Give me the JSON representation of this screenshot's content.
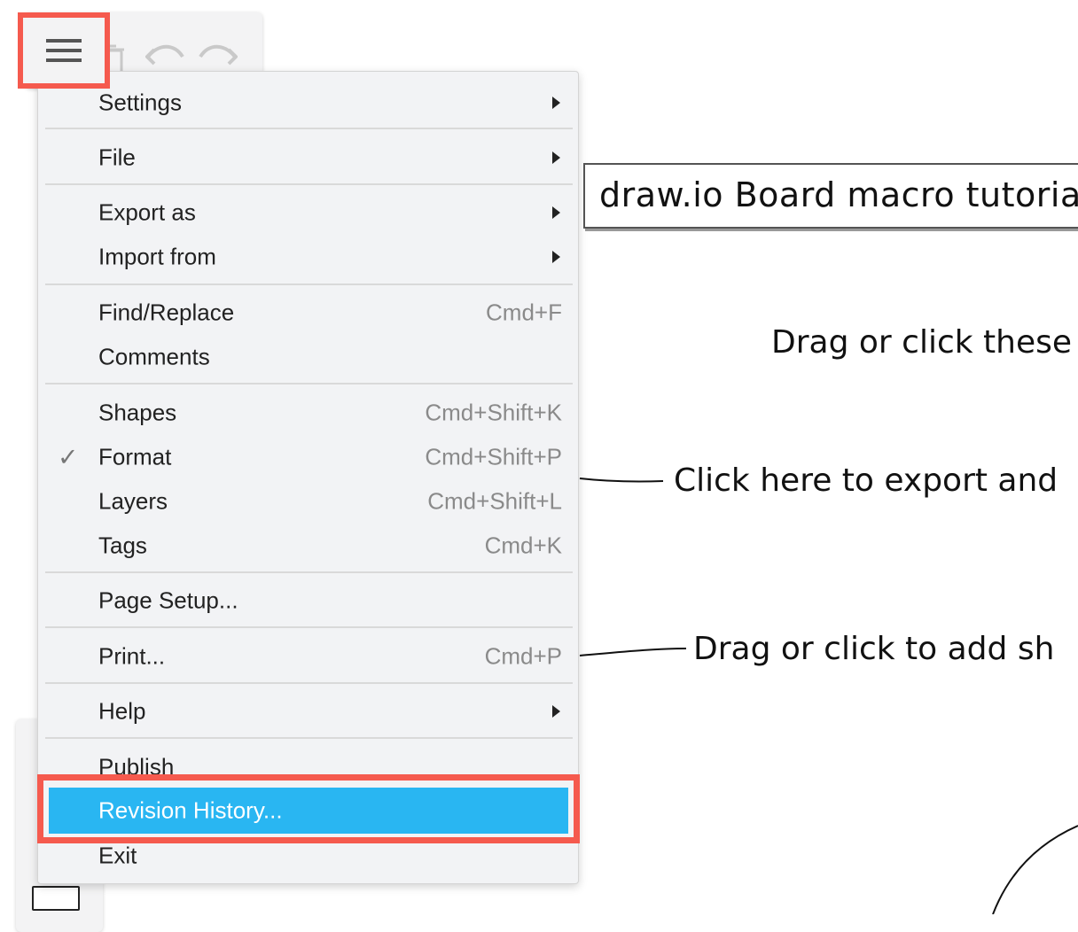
{
  "canvas": {
    "title": "draw.io Board macro tutorial",
    "note_drag_click": "Drag or click these",
    "note_export": "Click here to export and",
    "note_add_shapes": "Drag or click to add sh"
  },
  "toolbar": {
    "menu_icon": "hamburger-icon",
    "delete_icon": "trash-icon",
    "undo_icon": "undo-icon",
    "redo_icon": "redo-icon"
  },
  "menu": {
    "settings": "Settings",
    "file": "File",
    "export_as": "Export as",
    "import_from": "Import from",
    "find_replace": "Find/Replace",
    "find_replace_shortcut": "Cmd+F",
    "comments": "Comments",
    "shapes": "Shapes",
    "shapes_shortcut": "Cmd+Shift+K",
    "format": "Format",
    "format_shortcut": "Cmd+Shift+P",
    "format_checked": true,
    "layers": "Layers",
    "layers_shortcut": "Cmd+Shift+L",
    "tags": "Tags",
    "tags_shortcut": "Cmd+K",
    "page_setup": "Page Setup...",
    "print": "Print...",
    "print_shortcut": "Cmd+P",
    "help": "Help",
    "publish": "Publish",
    "revision_history": "Revision History...",
    "exit": "Exit"
  },
  "colors": {
    "highlight": "#29b6f2",
    "callout_outline": "#f55a4e",
    "menu_background": "#f2f3f5"
  }
}
